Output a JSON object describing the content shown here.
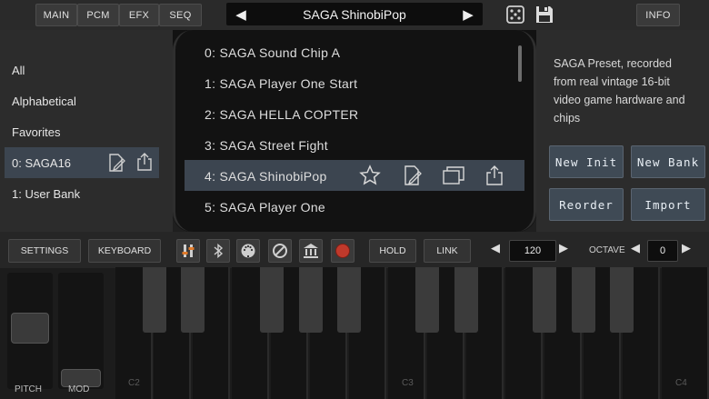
{
  "top_nav": {
    "tabs": [
      "MAIN",
      "PCM",
      "EFX",
      "SEQ"
    ],
    "preset_name": "SAGA ShinobiPop",
    "info_label": "INFO",
    "dice_icon": "dice-icon",
    "save_icon": "floppy-icon"
  },
  "banks": {
    "items": [
      "All",
      "Alphabetical",
      "Favorites",
      "0: SAGA16",
      "1: User Bank"
    ],
    "selected_index": 3
  },
  "presets": {
    "items": [
      "0: SAGA Sound Chip A",
      "1: SAGA Player One Start",
      "2: SAGA HELLA COPTER",
      "3: SAGA Street Fight",
      "4: SAGA ShinobiPop",
      "5: SAGA Player One"
    ],
    "selected_index": 4
  },
  "description": "SAGA Preset, recorded from real vintage 16-bit video game hardware and chips",
  "right_buttons": {
    "new_init": "New Init",
    "new_bank": "New Bank",
    "reorder": "Reorder",
    "import": "Import"
  },
  "controls": {
    "settings": "SETTINGS",
    "keyboard": "KEYBOARD",
    "hold": "HOLD",
    "link": "LINK",
    "tempo": "120",
    "octave_label": "OCTAVE",
    "octave": "0"
  },
  "keyboard": {
    "note_labels": [
      "C2",
      "C3",
      "C4"
    ],
    "pitch_label": "PITCH",
    "mod_label": "MOD"
  },
  "colors": {
    "selection": "#3c4550",
    "record": "#c0392b"
  }
}
